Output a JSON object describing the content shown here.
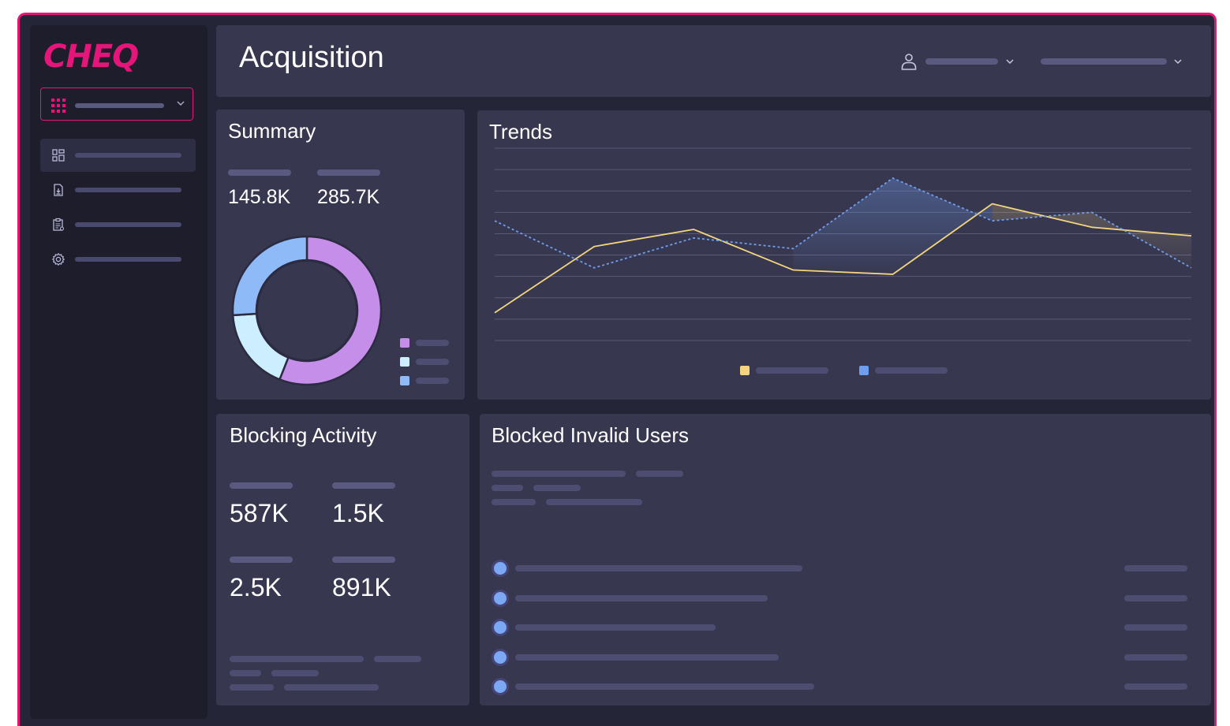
{
  "brand": {
    "logo": "CHEQ",
    "accent": "#e6157a"
  },
  "header": {
    "title": "Acquisition",
    "user_icon": "user-icon"
  },
  "sidebar": {
    "items": [
      {
        "icon": "dashboard-icon"
      },
      {
        "icon": "download-report-icon"
      },
      {
        "icon": "clipboard-icon"
      },
      {
        "icon": "gear-icon"
      }
    ]
  },
  "summary": {
    "title": "Summary",
    "stat1": "145.8K",
    "stat2": "285.7K",
    "donut": [
      {
        "value": 0.56,
        "color": "#c58ee8"
      },
      {
        "value": 0.18,
        "color": "#cdeeff"
      },
      {
        "value": 0.26,
        "color": "#8fbaf8"
      }
    ]
  },
  "trends": {
    "title": "Trends",
    "colors": {
      "series1": "#f3d57e",
      "series2": "#6f9ef0"
    }
  },
  "chart_data": {
    "type": "line",
    "x": [
      1,
      2,
      3,
      4,
      5,
      6,
      7,
      8
    ],
    "series": [
      {
        "values": [
          1.3,
          4.4,
          5.2,
          3.3,
          3.1,
          6.4,
          5.3,
          4.9
        ],
        "color": "#f3d57e",
        "style": "solid"
      },
      {
        "values": [
          5.6,
          3.4,
          4.8,
          4.3,
          7.6,
          5.6,
          6.0,
          3.4
        ],
        "color": "#6f9ef0",
        "style": "dashed"
      }
    ],
    "ylim": [
      0,
      9
    ],
    "grid": true,
    "legend": "bottom"
  },
  "blocking": {
    "title": "Blocking Activity",
    "values": [
      "587K",
      "1.5K",
      "2.5K",
      "891K"
    ]
  },
  "blocked_users": {
    "title": "Blocked Invalid Users",
    "rows": 5
  }
}
